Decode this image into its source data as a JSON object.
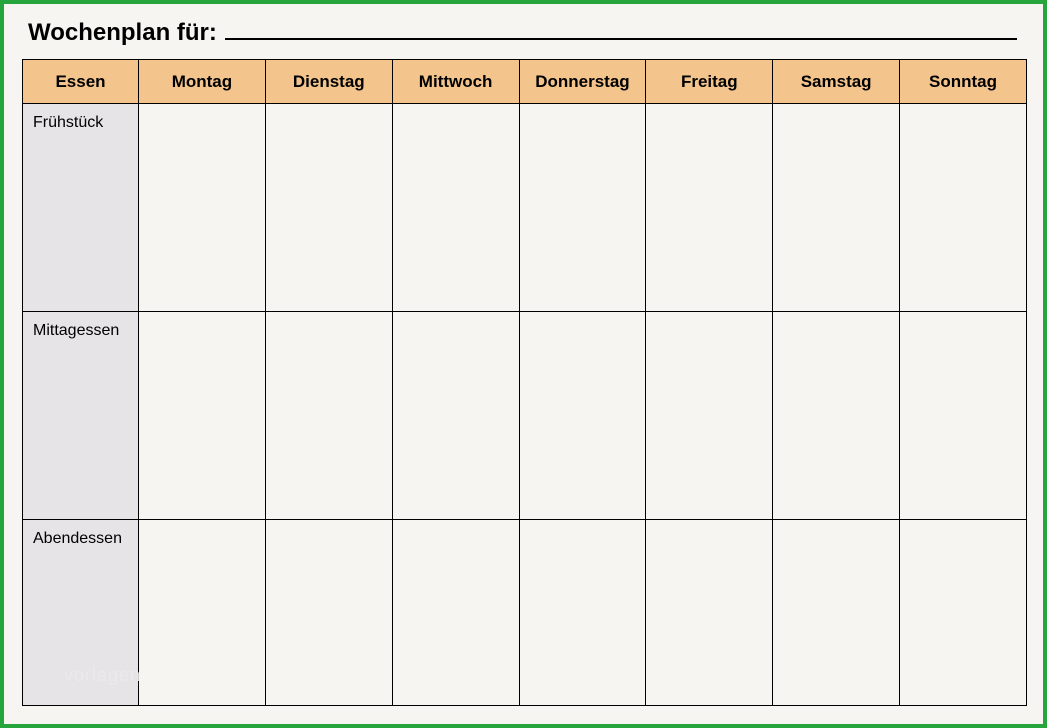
{
  "title": "Wochenplan für:",
  "columns": {
    "essen": "Essen",
    "days": [
      "Montag",
      "Dienstag",
      "Mittwoch",
      "Donnerstag",
      "Freitag",
      "Samstag",
      "Sonntag"
    ]
  },
  "rows": [
    "Frühstück",
    "Mittagessen",
    "Abendessen"
  ],
  "watermark": "vorlagen",
  "colors": {
    "border": "#27a53d",
    "header_bg": "#f4c48d",
    "rowheader_bg": "#e6e4e6",
    "page_bg": "#f6f5f1"
  }
}
